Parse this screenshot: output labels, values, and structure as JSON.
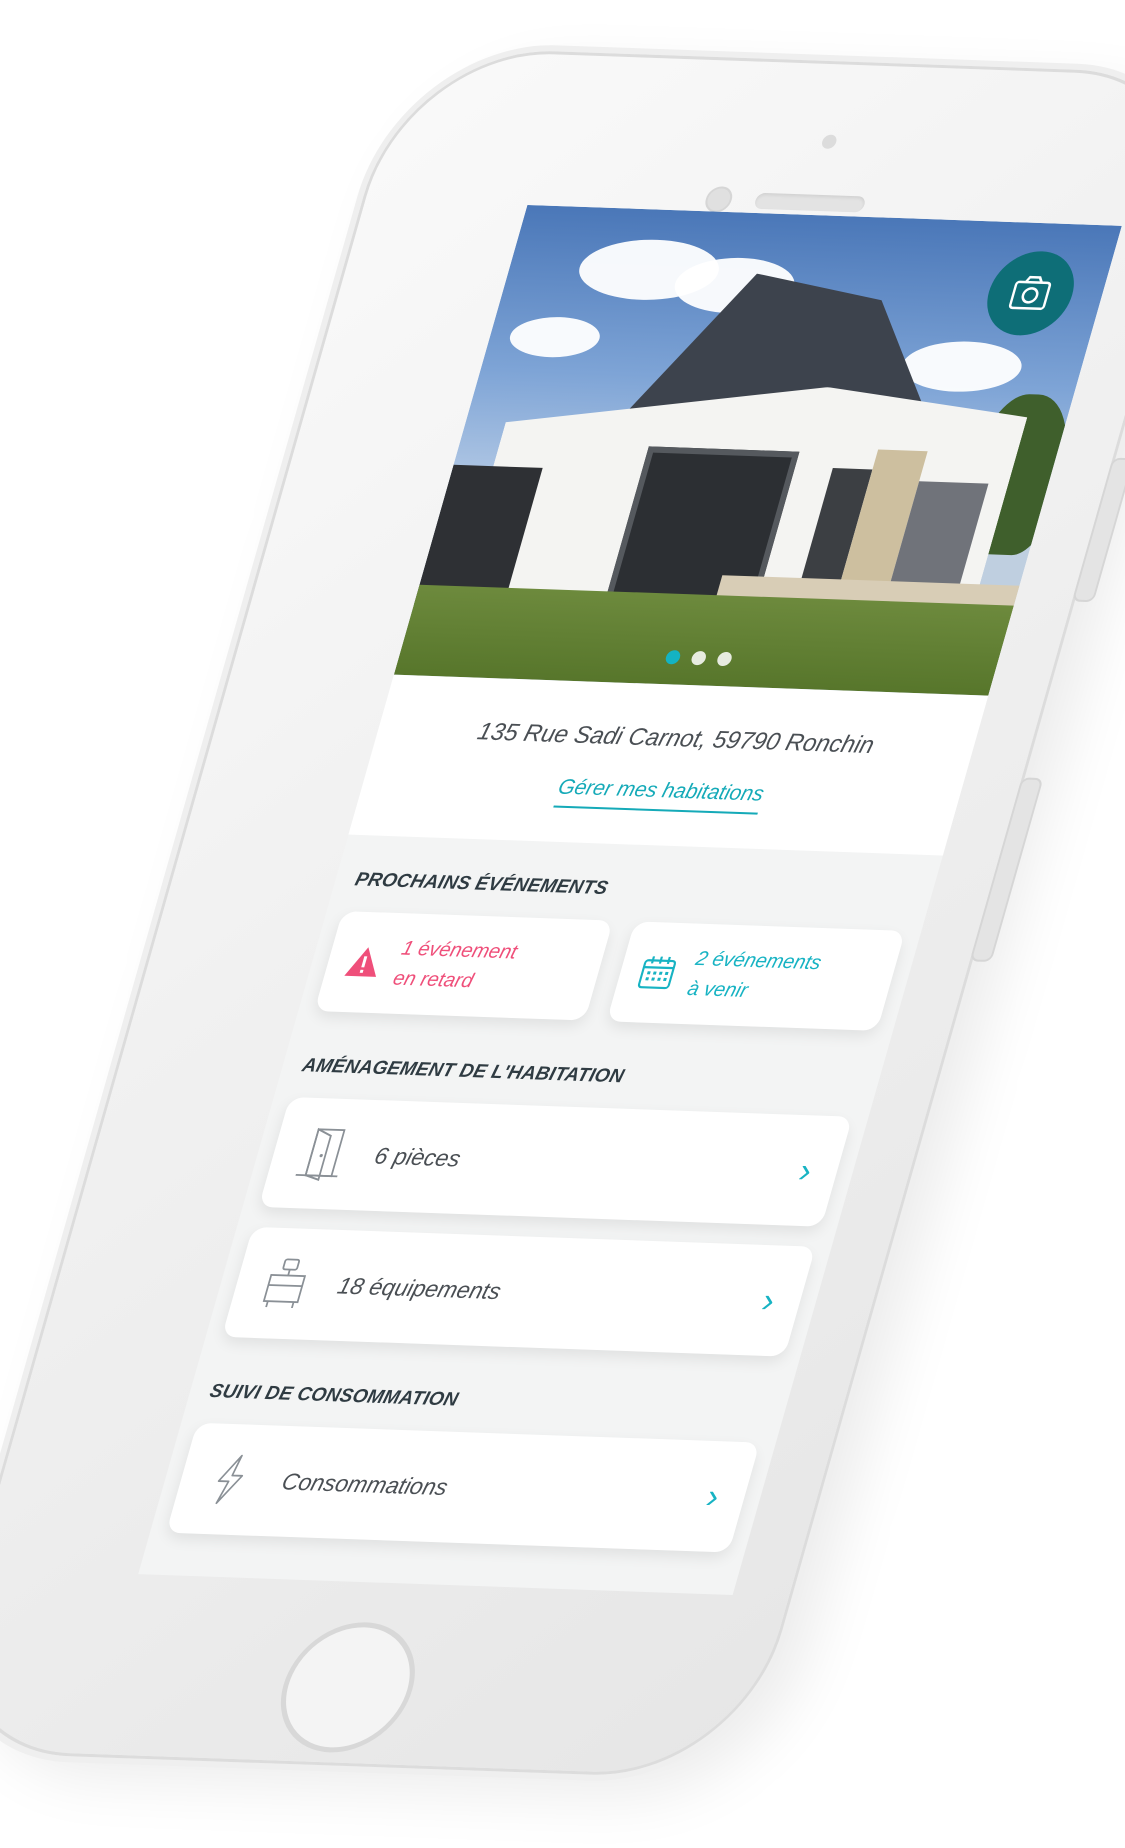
{
  "hero": {
    "carousel_dots": 3,
    "active_dot": 0
  },
  "home": {
    "address": "135 Rue Sadi Carnot, 59790 Ronchin",
    "manage_link": "Gérer mes habitations"
  },
  "events": {
    "title": "PROCHAINS ÉVÉNEMENTS",
    "late": {
      "line1": "1 événement",
      "line2": "en retard"
    },
    "upcoming": {
      "line1": "2 événements",
      "line2": "à venir"
    }
  },
  "layout_section": {
    "title": "AMÉNAGEMENT DE L'HABITATION",
    "items": [
      {
        "label": "6 pièces",
        "icon": "door-icon"
      },
      {
        "label": "18 équipements",
        "icon": "furniture-icon"
      }
    ]
  },
  "consumption": {
    "title": "SUIVI DE CONSOMMATION",
    "items": [
      {
        "label": "Consommations",
        "icon": "lightning-icon"
      }
    ]
  },
  "colors": {
    "accent": "#17b3c3",
    "alert": "#ef4f7a",
    "badge": "#0e6e77"
  }
}
